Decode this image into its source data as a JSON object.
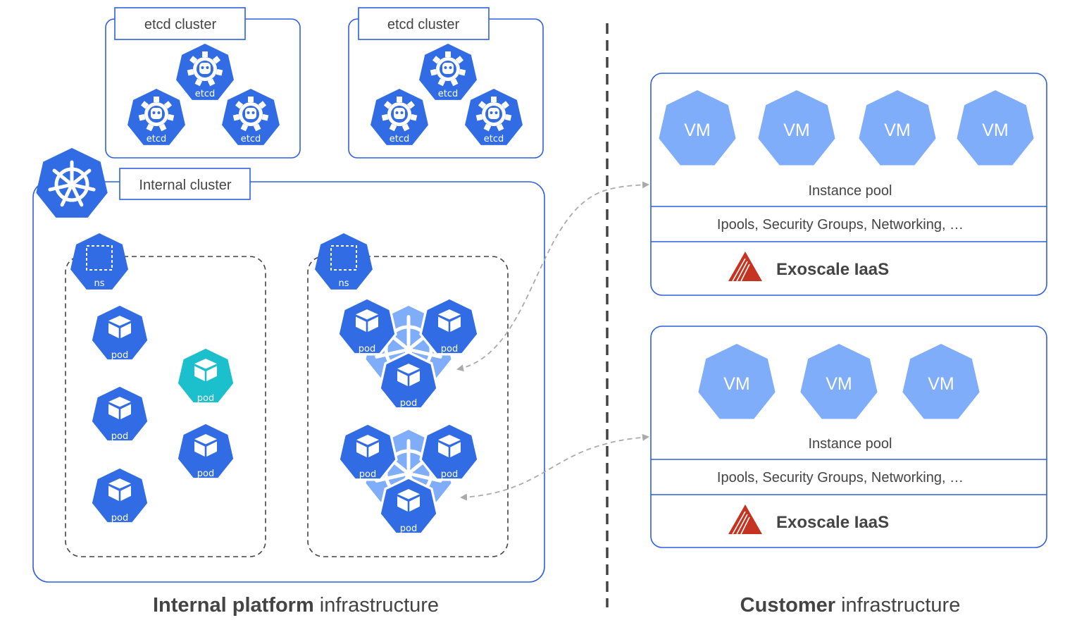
{
  "colors": {
    "k8s_blue": "#326ce5",
    "vm_blue": "#7fadfa",
    "highlight_teal": "#1cbfcc",
    "border_blue": "#2f5fe0",
    "dashed_gray": "#444444",
    "arrow_gray": "#aaaaaa",
    "exoscale_red": "#c43421",
    "text": "#444444"
  },
  "internal": {
    "etcd_clusters": [
      {
        "title": "etcd cluster",
        "members": [
          "etcd",
          "etcd",
          "etcd"
        ]
      },
      {
        "title": "etcd cluster",
        "members": [
          "etcd",
          "etcd",
          "etcd"
        ]
      }
    ],
    "cluster": {
      "title": "Internal cluster",
      "icon": "kubernetes-helm-icon",
      "namespaces": [
        {
          "icon_label": "ns",
          "pods": [
            {
              "label": "pod",
              "highlight": false
            },
            {
              "label": "pod",
              "highlight": false
            },
            {
              "label": "pod",
              "highlight": false
            },
            {
              "label": "pod",
              "highlight": true
            },
            {
              "label": "pod",
              "highlight": false
            }
          ]
        },
        {
          "icon_label": "ns",
          "control_planes": [
            {
              "pods": [
                "pod",
                "pod",
                "pod"
              ]
            },
            {
              "pods": [
                "pod",
                "pod",
                "pod"
              ]
            }
          ]
        }
      ]
    },
    "caption_bold": "Internal platform",
    "caption_regular": " infrastructure"
  },
  "customer": {
    "pools": [
      {
        "vms": [
          "VM",
          "VM",
          "VM",
          "VM"
        ],
        "pool_label": "Instance pool",
        "resources_label": "Ipools, Security Groups, Networking, …",
        "provider_label": "Exoscale IaaS"
      },
      {
        "vms": [
          "VM",
          "VM",
          "VM"
        ],
        "pool_label": "Instance pool",
        "resources_label": "Ipools, Security Groups, Networking, …",
        "provider_label": "Exoscale IaaS"
      }
    ],
    "caption_bold": "Customer",
    "caption_regular": " infrastructure"
  }
}
